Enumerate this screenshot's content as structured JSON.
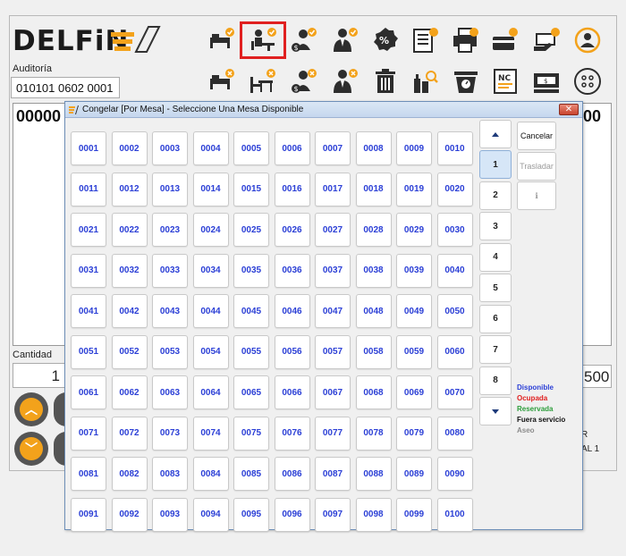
{
  "app": {
    "logo_text": "DELFiN",
    "audit_label": "Auditoría",
    "audit_value": "010101 0602 0001",
    "order_code_left": "00000",
    "order_code_right": "00",
    "quantity_label": "Cantidad",
    "quantity_value": "1",
    "price_value": "500",
    "side_text_1": "R",
    "side_text_2": "AL 1"
  },
  "toolbar": {
    "row1": [
      "bed-check-icon",
      "table-service-icon",
      "waiter-money-icon",
      "person-check-icon",
      "percent-icon",
      "document-icon",
      "printer-icon",
      "card-payment-icon",
      "cash-hand-icon",
      "user-sync-icon"
    ],
    "row2": [
      "bed-cancel-icon",
      "table-cancel-icon",
      "waiter-cancel-icon",
      "person-cancel-icon",
      "trash-icon",
      "bottles-search-icon",
      "scale-icon",
      "credit-note-icon",
      "cash-register-icon",
      "more-icon"
    ],
    "selected_index": 1
  },
  "dialog": {
    "title": "Congelar [Por Mesa] - Seleccione Una Mesa Disponible",
    "close_label": "✕",
    "tables": [
      "0001",
      "0002",
      "0003",
      "0004",
      "0005",
      "0006",
      "0007",
      "0008",
      "0009",
      "0010",
      "0011",
      "0012",
      "0013",
      "0014",
      "0015",
      "0016",
      "0017",
      "0018",
      "0019",
      "0020",
      "0021",
      "0022",
      "0023",
      "0024",
      "0025",
      "0026",
      "0027",
      "0028",
      "0029",
      "0030",
      "0031",
      "0032",
      "0033",
      "0034",
      "0035",
      "0036",
      "0037",
      "0038",
      "0039",
      "0040",
      "0041",
      "0042",
      "0043",
      "0044",
      "0045",
      "0046",
      "0047",
      "0048",
      "0049",
      "0050",
      "0051",
      "0052",
      "0053",
      "0054",
      "0055",
      "0056",
      "0057",
      "0058",
      "0059",
      "0060",
      "0061",
      "0062",
      "0063",
      "0064",
      "0065",
      "0066",
      "0067",
      "0068",
      "0069",
      "0070",
      "0071",
      "0072",
      "0073",
      "0074",
      "0075",
      "0076",
      "0077",
      "0078",
      "0079",
      "0080",
      "0081",
      "0082",
      "0083",
      "0084",
      "0085",
      "0086",
      "0087",
      "0088",
      "0089",
      "0090",
      "0091",
      "0092",
      "0093",
      "0094",
      "0095",
      "0096",
      "0097",
      "0098",
      "0099",
      "0100"
    ],
    "pages": [
      "1",
      "2",
      "3",
      "4",
      "5",
      "6",
      "7",
      "8"
    ],
    "active_page": "1",
    "cancel_label": "Cancelar",
    "traslado_label": "Trasladar",
    "info_label": "ℹ",
    "legend": [
      {
        "label": "Disponible",
        "color": "#2b3fd6"
      },
      {
        "label": "Ocupada",
        "color": "#e02020"
      },
      {
        "label": "Reservada",
        "color": "#2e9e3c"
      },
      {
        "label": "Fuera servicio",
        "color": "#111111"
      },
      {
        "label": "Aseo",
        "color": "#8c8c8c"
      }
    ]
  },
  "colors": {
    "accent_orange": "#f3a21b",
    "accent_red": "#e02020",
    "icon_dark": "#2d2d2d"
  }
}
